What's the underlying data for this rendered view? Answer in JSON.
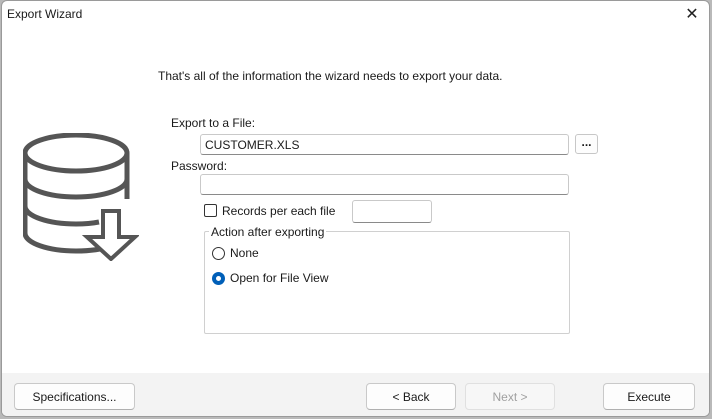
{
  "window": {
    "title": "Export Wizard"
  },
  "intro_text": "That's all of the information the wizard needs to export your data.",
  "export_file": {
    "label": "Export to a File:",
    "value": "CUSTOMER.XLS",
    "browse_label": "..."
  },
  "password": {
    "label": "Password:",
    "value": ""
  },
  "records": {
    "label": "Records per each file",
    "checked": false,
    "value": ""
  },
  "action": {
    "legend": "Action after exporting",
    "options": [
      {
        "label": "None",
        "selected": false
      },
      {
        "label": "Open for File View",
        "selected": true
      }
    ]
  },
  "footer": {
    "specifications_label": "Specifications...",
    "back_label": "< Back",
    "next_label": "Next >",
    "execute_label": "Execute"
  },
  "icons": {
    "close": "close-icon",
    "database": "database-export-icon"
  },
  "colors": {
    "accent": "#005fb8",
    "footer_bg": "#f3f3f3"
  }
}
